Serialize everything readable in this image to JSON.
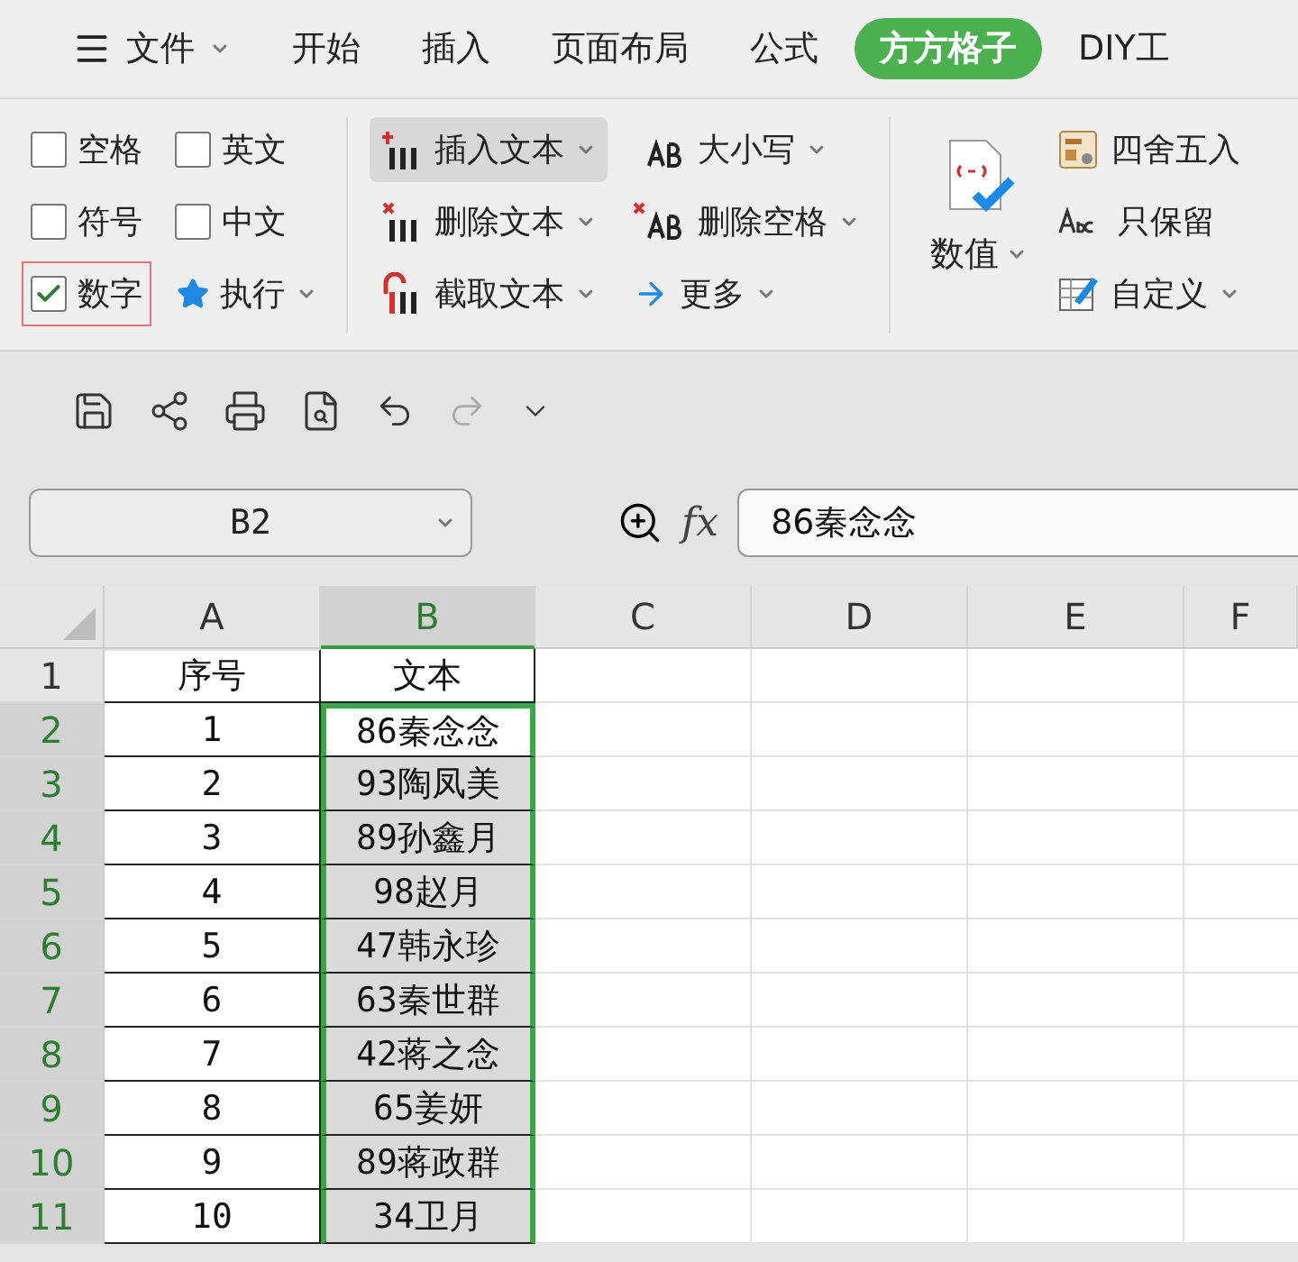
{
  "menu": {
    "items": [
      {
        "label": "文件",
        "kind": "file",
        "selected": false
      },
      {
        "label": "开始",
        "kind": "tab",
        "selected": false
      },
      {
        "label": "插入",
        "kind": "tab",
        "selected": false
      },
      {
        "label": "页面布局",
        "kind": "tab",
        "selected": false
      },
      {
        "label": "公式",
        "kind": "tab",
        "selected": false
      },
      {
        "label": "方方格子",
        "kind": "tab",
        "selected": true
      },
      {
        "label": "DIY工",
        "kind": "tab",
        "selected": false
      }
    ]
  },
  "ribbon": {
    "checkboxes": [
      {
        "label": "空格",
        "checked": false,
        "highlighted": false
      },
      {
        "label": "英文",
        "checked": false,
        "highlighted": false
      },
      {
        "label": "符号",
        "checked": false,
        "highlighted": false
      },
      {
        "label": "中文",
        "checked": false,
        "highlighted": false
      },
      {
        "label": "数字",
        "checked": true,
        "highlighted": true
      }
    ],
    "run_button": {
      "label": "执行"
    },
    "text_tools": [
      {
        "label": "插入文本",
        "selected": true
      },
      {
        "label": "大小写",
        "selected": false
      },
      {
        "label": "删除文本",
        "selected": false
      },
      {
        "label": "删除空格",
        "selected": false
      },
      {
        "label": "截取文本",
        "selected": false
      },
      {
        "label": "更多",
        "selected": false
      }
    ],
    "value_button": {
      "label": "数值"
    },
    "number_tools": [
      {
        "label": "四舍五入"
      },
      {
        "label": "只保留"
      },
      {
        "label": "自定义"
      }
    ]
  },
  "formula_bar": {
    "name_box": "B2",
    "fx_label": "fx",
    "formula": "86秦念念"
  },
  "sheet": {
    "columns": [
      {
        "label": "A",
        "selected": false
      },
      {
        "label": "B",
        "selected": true
      },
      {
        "label": "C",
        "selected": false
      },
      {
        "label": "D",
        "selected": false
      },
      {
        "label": "E",
        "selected": false
      },
      {
        "label": "F",
        "selected": false
      }
    ],
    "rows": [
      {
        "number": "1",
        "selected": false,
        "active": false,
        "cells": [
          "序号",
          "文本"
        ]
      },
      {
        "number": "2",
        "selected": true,
        "active": true,
        "cells": [
          "1",
          "86秦念念"
        ]
      },
      {
        "number": "3",
        "selected": true,
        "active": false,
        "cells": [
          "2",
          "93陶凤美"
        ]
      },
      {
        "number": "4",
        "selected": true,
        "active": false,
        "cells": [
          "3",
          "89孙鑫月"
        ]
      },
      {
        "number": "5",
        "selected": true,
        "active": false,
        "cells": [
          "4",
          "98赵月"
        ]
      },
      {
        "number": "6",
        "selected": true,
        "active": false,
        "cells": [
          "5",
          "47韩永珍"
        ]
      },
      {
        "number": "7",
        "selected": true,
        "active": false,
        "cells": [
          "6",
          "63秦世群"
        ]
      },
      {
        "number": "8",
        "selected": true,
        "active": false,
        "cells": [
          "7",
          "42蒋之念"
        ]
      },
      {
        "number": "9",
        "selected": true,
        "active": false,
        "cells": [
          "8",
          "65姜妍"
        ]
      },
      {
        "number": "10",
        "selected": true,
        "active": false,
        "cells": [
          "9",
          "89蒋政群"
        ]
      },
      {
        "number": "11",
        "selected": true,
        "active": false,
        "cells": [
          "10",
          "34卫月"
        ]
      }
    ]
  }
}
